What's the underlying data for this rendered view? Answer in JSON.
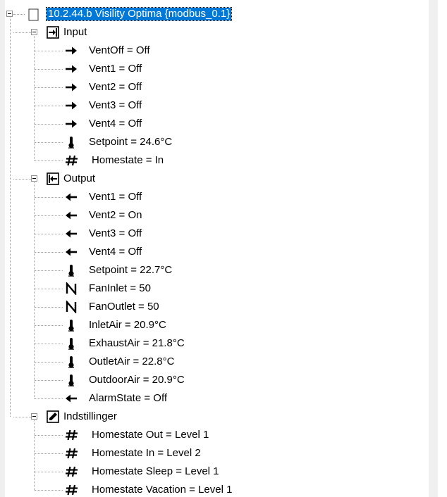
{
  "tree": {
    "root": {
      "label": "10.2.44.b Visility Optima {modbus_0.1}"
    },
    "groups": [
      {
        "label": "Input",
        "icon": "input-arrow-icon",
        "items": [
          {
            "label": "VentOff = Off",
            "icon": "arrow-right-icon"
          },
          {
            "label": "Vent1 = Off",
            "icon": "arrow-right-icon"
          },
          {
            "label": "Vent2 = Off",
            "icon": "arrow-right-icon"
          },
          {
            "label": "Vent3 = Off",
            "icon": "arrow-right-icon"
          },
          {
            "label": "Vent4 = Off",
            "icon": "arrow-right-icon"
          },
          {
            "label": "Setpoint = 24.6°C",
            "icon": "thermometer-icon"
          },
          {
            "label": "Homestate = In",
            "icon": "hash-icon"
          }
        ]
      },
      {
        "label": "Output",
        "icon": "output-arrow-icon",
        "items": [
          {
            "label": "Vent1 = Off",
            "icon": "arrow-left-icon"
          },
          {
            "label": "Vent2 = On",
            "icon": "arrow-left-icon"
          },
          {
            "label": "Vent3 = Off",
            "icon": "arrow-left-icon"
          },
          {
            "label": "Vent4 = Off",
            "icon": "arrow-left-icon"
          },
          {
            "label": "Setpoint = 22.7°C",
            "icon": "thermometer-icon"
          },
          {
            "label": "FanInlet = 50",
            "icon": "n-icon"
          },
          {
            "label": "FanOutlet = 50",
            "icon": "n-icon"
          },
          {
            "label": "InletAir = 20.9°C",
            "icon": "thermometer-icon"
          },
          {
            "label": "ExhaustAir = 21.8°C",
            "icon": "thermometer-icon"
          },
          {
            "label": "OutletAir = 22.8°C",
            "icon": "thermometer-icon"
          },
          {
            "label": "OutdoorAir = 20.9°C",
            "icon": "thermometer-icon"
          },
          {
            "label": "AlarmState = Off",
            "icon": "arrow-left-icon"
          }
        ]
      },
      {
        "label": "Indstillinger",
        "icon": "settings-pencil-icon",
        "items": [
          {
            "label": "Homestate Out = Level 1",
            "icon": "hash-icon"
          },
          {
            "label": "Homestate In = Level 2",
            "icon": "hash-icon"
          },
          {
            "label": "Homestate Sleep = Level 1",
            "icon": "hash-icon"
          },
          {
            "label": "Homestate Vacation = Level 1",
            "icon": "hash-icon"
          }
        ]
      }
    ]
  }
}
